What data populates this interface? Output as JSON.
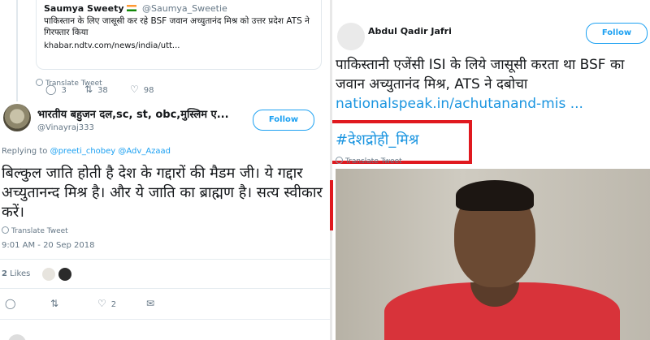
{
  "left": {
    "quoted": {
      "name": "Saumya Sweety",
      "handle": "@Saumya_Sweetie",
      "text": "पाकिस्तान के लिए जासूसी कर रहे BSF जवान अच्युतानंद मिश्र को उत्तर प्रदेश ATS ने गिरफ्तार किया",
      "link": "khabar.ndtv.com/news/india/utt...",
      "translate": "Translate Tweet",
      "reply_count": "3",
      "retweet_count": "38",
      "like_count": "98"
    },
    "tweet": {
      "name": "भारतीय बहुजन दल,sc, st, obc,मुस्लिम ए...",
      "handle": "@Vinayraj333",
      "follow_label": "Follow",
      "replying_prefix": "Replying to",
      "replying_to_1": "@preeti_chobey",
      "replying_to_2": "@Adv_Azaad",
      "text": "बिल्कुल जाति होती है देश के गद्दारों की मैडम जी। ये गद्दार अच्युतानन्द मिश्र है। और ये जाति का ब्राह्मण है। सत्य स्वीकार करें।",
      "translate": "Translate Tweet",
      "timestamp": "9:01 AM - 20 Sep 2018",
      "likes_count": "2",
      "likes_label": "Likes",
      "reply_count": "",
      "retweet_count": "",
      "like_count": "2"
    }
  },
  "right": {
    "name": "Abdul Qadir Jafri",
    "follow_label": "Follow",
    "text": "पाकिस्तानी एजेंसी ISI के लिये जासूसी करता था BSF का जवान अच्युतानंद मिश्र, ATS ने दबोचा",
    "link": "nationalspeak.in/achutanand-mis ...",
    "hashtag": "#देशद्रोही_मिश्र",
    "translate": "Translate Tweet"
  },
  "icons": {
    "reply": "reply-icon",
    "retweet": "retweet-icon",
    "like": "heart-icon",
    "globe": "globe-icon"
  },
  "colors": {
    "accent": "#1da1f2",
    "highlight_box": "#e0191f"
  }
}
